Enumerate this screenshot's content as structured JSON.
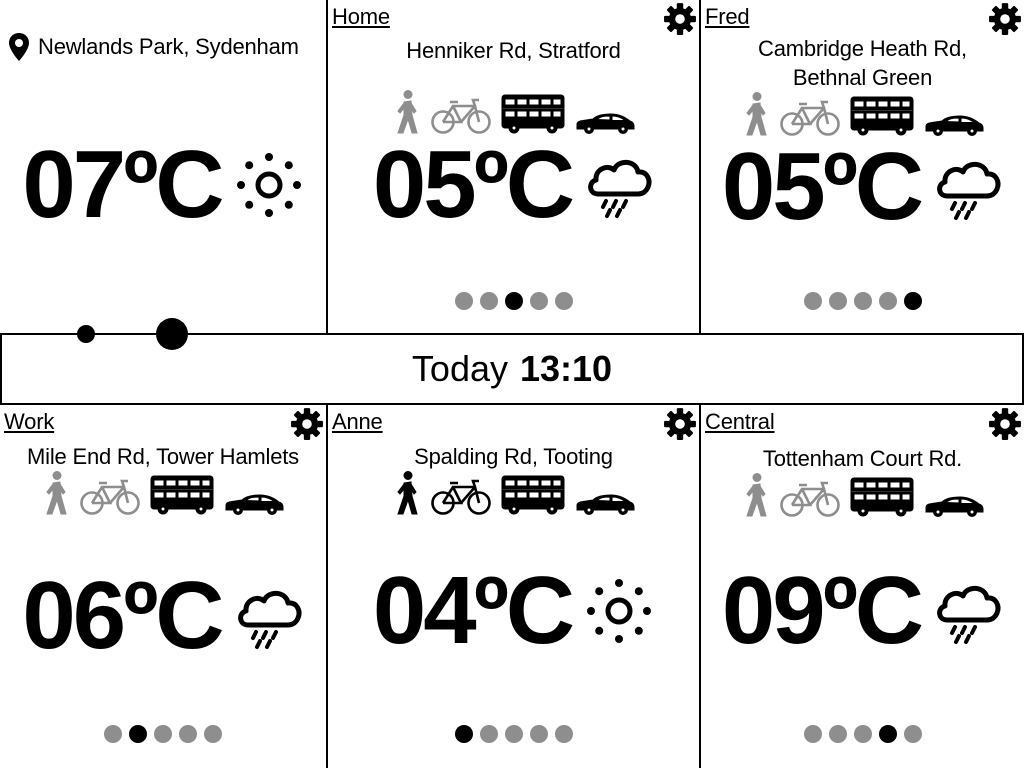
{
  "timebar": {
    "today": "Today",
    "time": "13:10"
  },
  "current": {
    "location": "Newlands Park, Sydenham",
    "temperature": "07ºC",
    "weather_icon": "sun-icon"
  },
  "places": {
    "home": {
      "name": "Home",
      "address": "Henniker Rd, Stratford",
      "temperature": "05ºC",
      "weather_icon": "rain-icon",
      "transport_active": [
        "bus",
        "car"
      ],
      "active_dot": 3,
      "dot_count": 5
    },
    "fred": {
      "name": "Fred",
      "address_line1": "Cambridge Heath Rd,",
      "address_line2": "Bethnal Green",
      "temperature": "05ºC",
      "weather_icon": "rain-icon",
      "transport_active": [
        "bus",
        "car"
      ],
      "active_dot": 5,
      "dot_count": 5
    },
    "work": {
      "name": "Work",
      "address": "Mile End Rd, Tower Hamlets",
      "temperature": "06ºC",
      "weather_icon": "rain-icon",
      "transport_active": [
        "bus",
        "car"
      ],
      "active_dot": 2,
      "dot_count": 5
    },
    "anne": {
      "name": "Anne",
      "address": "Spalding Rd, Tooting",
      "temperature": "04ºC",
      "weather_icon": "sun-icon",
      "transport_active": [
        "walk",
        "bike",
        "bus",
        "car"
      ],
      "active_dot": 1,
      "dot_count": 5
    },
    "central": {
      "name": "Central",
      "address": "Tottenham Court Rd.",
      "temperature": "09ºC",
      "weather_icon": "rain-icon",
      "transport_active": [
        "bus",
        "car"
      ],
      "active_dot": 4,
      "dot_count": 5
    }
  },
  "colors": {
    "active": "#000000",
    "inactive": "#8e8e8e",
    "background": "#ffffff"
  },
  "icons": {
    "walk": "walking-person-icon",
    "bike": "bicycle-icon",
    "bus": "double-decker-bus-icon",
    "car": "car-icon",
    "gear": "gear-icon",
    "pin": "location-pin-icon"
  }
}
